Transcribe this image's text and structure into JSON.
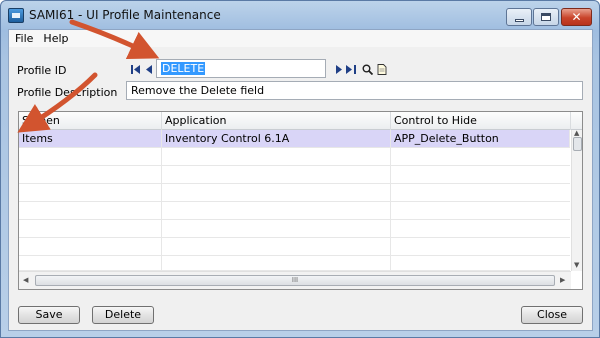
{
  "window": {
    "title": "SAMI61 - UI Profile Maintenance"
  },
  "menu": {
    "items": [
      "File",
      "Help"
    ]
  },
  "form": {
    "profile_id_label": "Profile ID",
    "profile_id_value": "DELETE",
    "profile_description_label": "Profile Description",
    "profile_description_value": "Remove the Delete field"
  },
  "grid": {
    "columns": [
      "Screen",
      "Application",
      "Control to Hide"
    ],
    "rows": [
      [
        "Items",
        "Inventory Control 6.1A",
        "APP_Delete_Button"
      ]
    ],
    "hscroll_grip": "III"
  },
  "buttons": {
    "save": "Save",
    "delete": "Delete",
    "close": "Close"
  },
  "colors": {
    "annotation_arrow": "#d2542f",
    "selected_row": "#d9d5f7",
    "close_button": "#c9442b"
  },
  "icons": [
    "first-record-icon",
    "previous-record-icon",
    "next-record-icon",
    "last-record-icon",
    "lookup-icon",
    "memo-icon",
    "minimize-icon",
    "maximize-icon",
    "close-icon"
  ]
}
